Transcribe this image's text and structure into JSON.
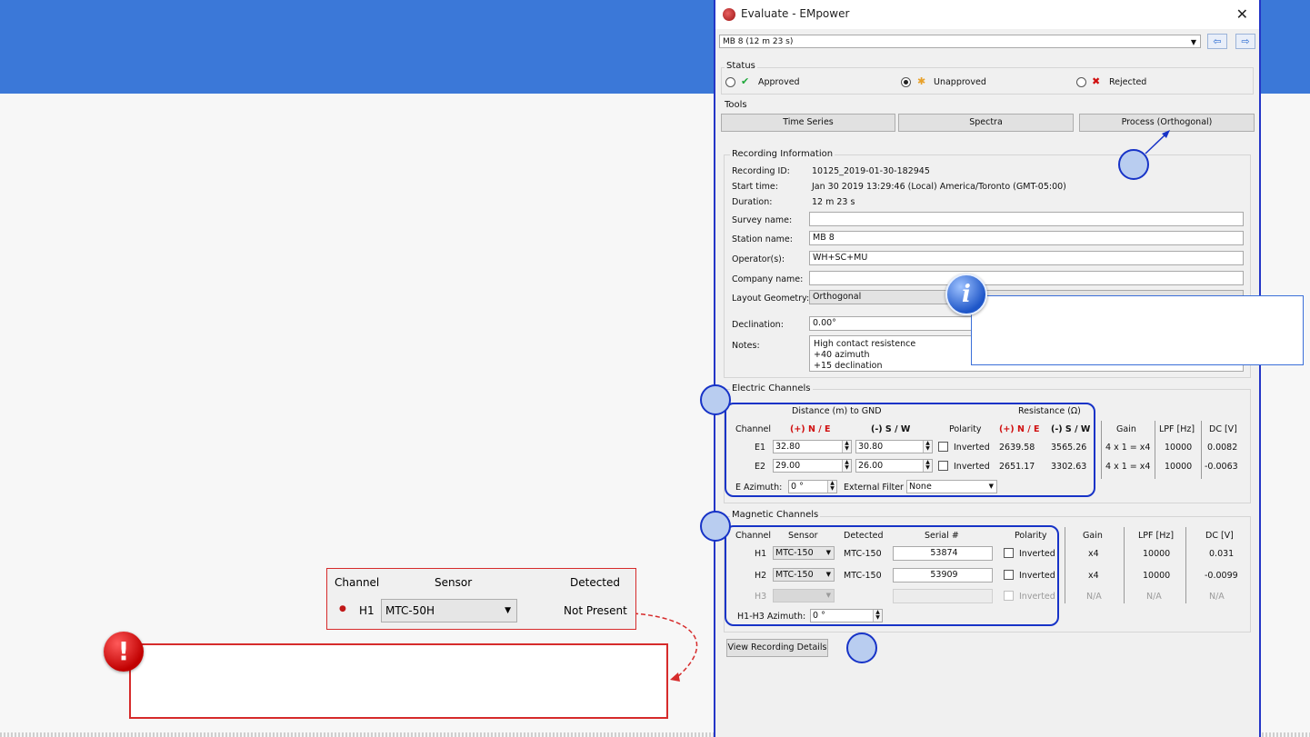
{
  "window": {
    "title": "Evaluate - EMpower"
  },
  "recording_select": {
    "value": "MB 8   (12 m 23 s)"
  },
  "status": {
    "title": "Status",
    "options": [
      {
        "label": "Approved",
        "selected": false
      },
      {
        "label": "Unapproved",
        "selected": true
      },
      {
        "label": "Rejected",
        "selected": false
      }
    ]
  },
  "tools": {
    "title": "Tools",
    "buttons": [
      "Time Series",
      "Spectra",
      "Process (Orthogonal)"
    ]
  },
  "recording_info": {
    "title": "Recording Information",
    "recording_id_label": "Recording ID:",
    "recording_id": "10125_2019-01-30-182945",
    "start_time_label": "Start time:",
    "start_time": "Jan 30 2019 13:29:46 (Local) America/Toronto (GMT-05:00)",
    "duration_label": "Duration:",
    "duration": "12 m 23 s",
    "survey_name_label": "Survey name:",
    "survey_name": "",
    "station_name_label": "Station name:",
    "station_name": "MB 8",
    "operators_label": "Operator(s):",
    "operators": "WH+SC+MU",
    "company_name_label": "Company name:",
    "company_name": "",
    "layout_geometry_label": "Layout Geometry:",
    "layout_geometry": "Orthogonal",
    "declination_label": "Declination:",
    "declination": "0.00°",
    "notes_label": "Notes:",
    "notes_lines": [
      "High contact resistence",
      "+40 azimuth",
      "+15 declination"
    ]
  },
  "electric": {
    "title": "Electric Channels",
    "distance_header": "Distance (m) to GND",
    "resistance_header": "Resistance (Ω)",
    "col_channel": "Channel",
    "col_ne": "(+) N / E",
    "col_sw": "(-) S / W",
    "col_polarity": "Polarity",
    "col_gain": "Gain",
    "col_lpf": "LPF [Hz]",
    "col_dc": "DC [V]",
    "rows": [
      {
        "channel": "E1",
        "dist_ne": "32.80",
        "dist_sw": "30.80",
        "polarity": "Inverted",
        "res_ne": "2639.58",
        "res_sw": "3565.26",
        "gain": "4 x 1 = x4",
        "lpf": "10000",
        "dc": "0.0082"
      },
      {
        "channel": "E2",
        "dist_ne": "29.00",
        "dist_sw": "26.00",
        "polarity": "Inverted",
        "res_ne": "2651.17",
        "res_sw": "3302.63",
        "gain": "4 x 1 = x4",
        "lpf": "10000",
        "dc": "-0.0063"
      }
    ],
    "azimuth_label": "E Azimuth:",
    "azimuth": "0 °",
    "filter_label": "External Filter",
    "filter": "None"
  },
  "magnetic": {
    "title": "Magnetic Channels",
    "col_channel": "Channel",
    "col_sensor": "Sensor",
    "col_detected": "Detected",
    "col_serial": "Serial #",
    "col_polarity": "Polarity",
    "col_gain": "Gain",
    "col_lpf": "LPF [Hz]",
    "col_dc": "DC [V]",
    "rows": [
      {
        "channel": "H1",
        "sensor": "MTC-150",
        "detected": "MTC-150",
        "serial": "53874",
        "polarity": "Inverted",
        "gain": "x4",
        "lpf": "10000",
        "dc": "0.031"
      },
      {
        "channel": "H2",
        "sensor": "MTC-150",
        "detected": "MTC-150",
        "serial": "53909",
        "polarity": "Inverted",
        "gain": "x4",
        "lpf": "10000",
        "dc": "-0.0099"
      },
      {
        "channel": "H3",
        "sensor": "",
        "detected": "",
        "serial": "",
        "polarity": "Inverted",
        "gain": "N/A",
        "lpf": "N/A",
        "dc": "N/A"
      }
    ],
    "azimuth_label": "H1-H3 Azimuth:",
    "azimuth": "0 °"
  },
  "view_details_button": "View Recording Details",
  "callout": {
    "col_channel": "Channel",
    "col_sensor": "Sensor",
    "col_detected": "Detected",
    "channel": "H1",
    "sensor": "MTC-50H",
    "detected": "Not Present"
  },
  "colors": {
    "banner": "#3b78d8",
    "annotation_blue": "#1733c7",
    "alert_red": "#d62b2b"
  }
}
